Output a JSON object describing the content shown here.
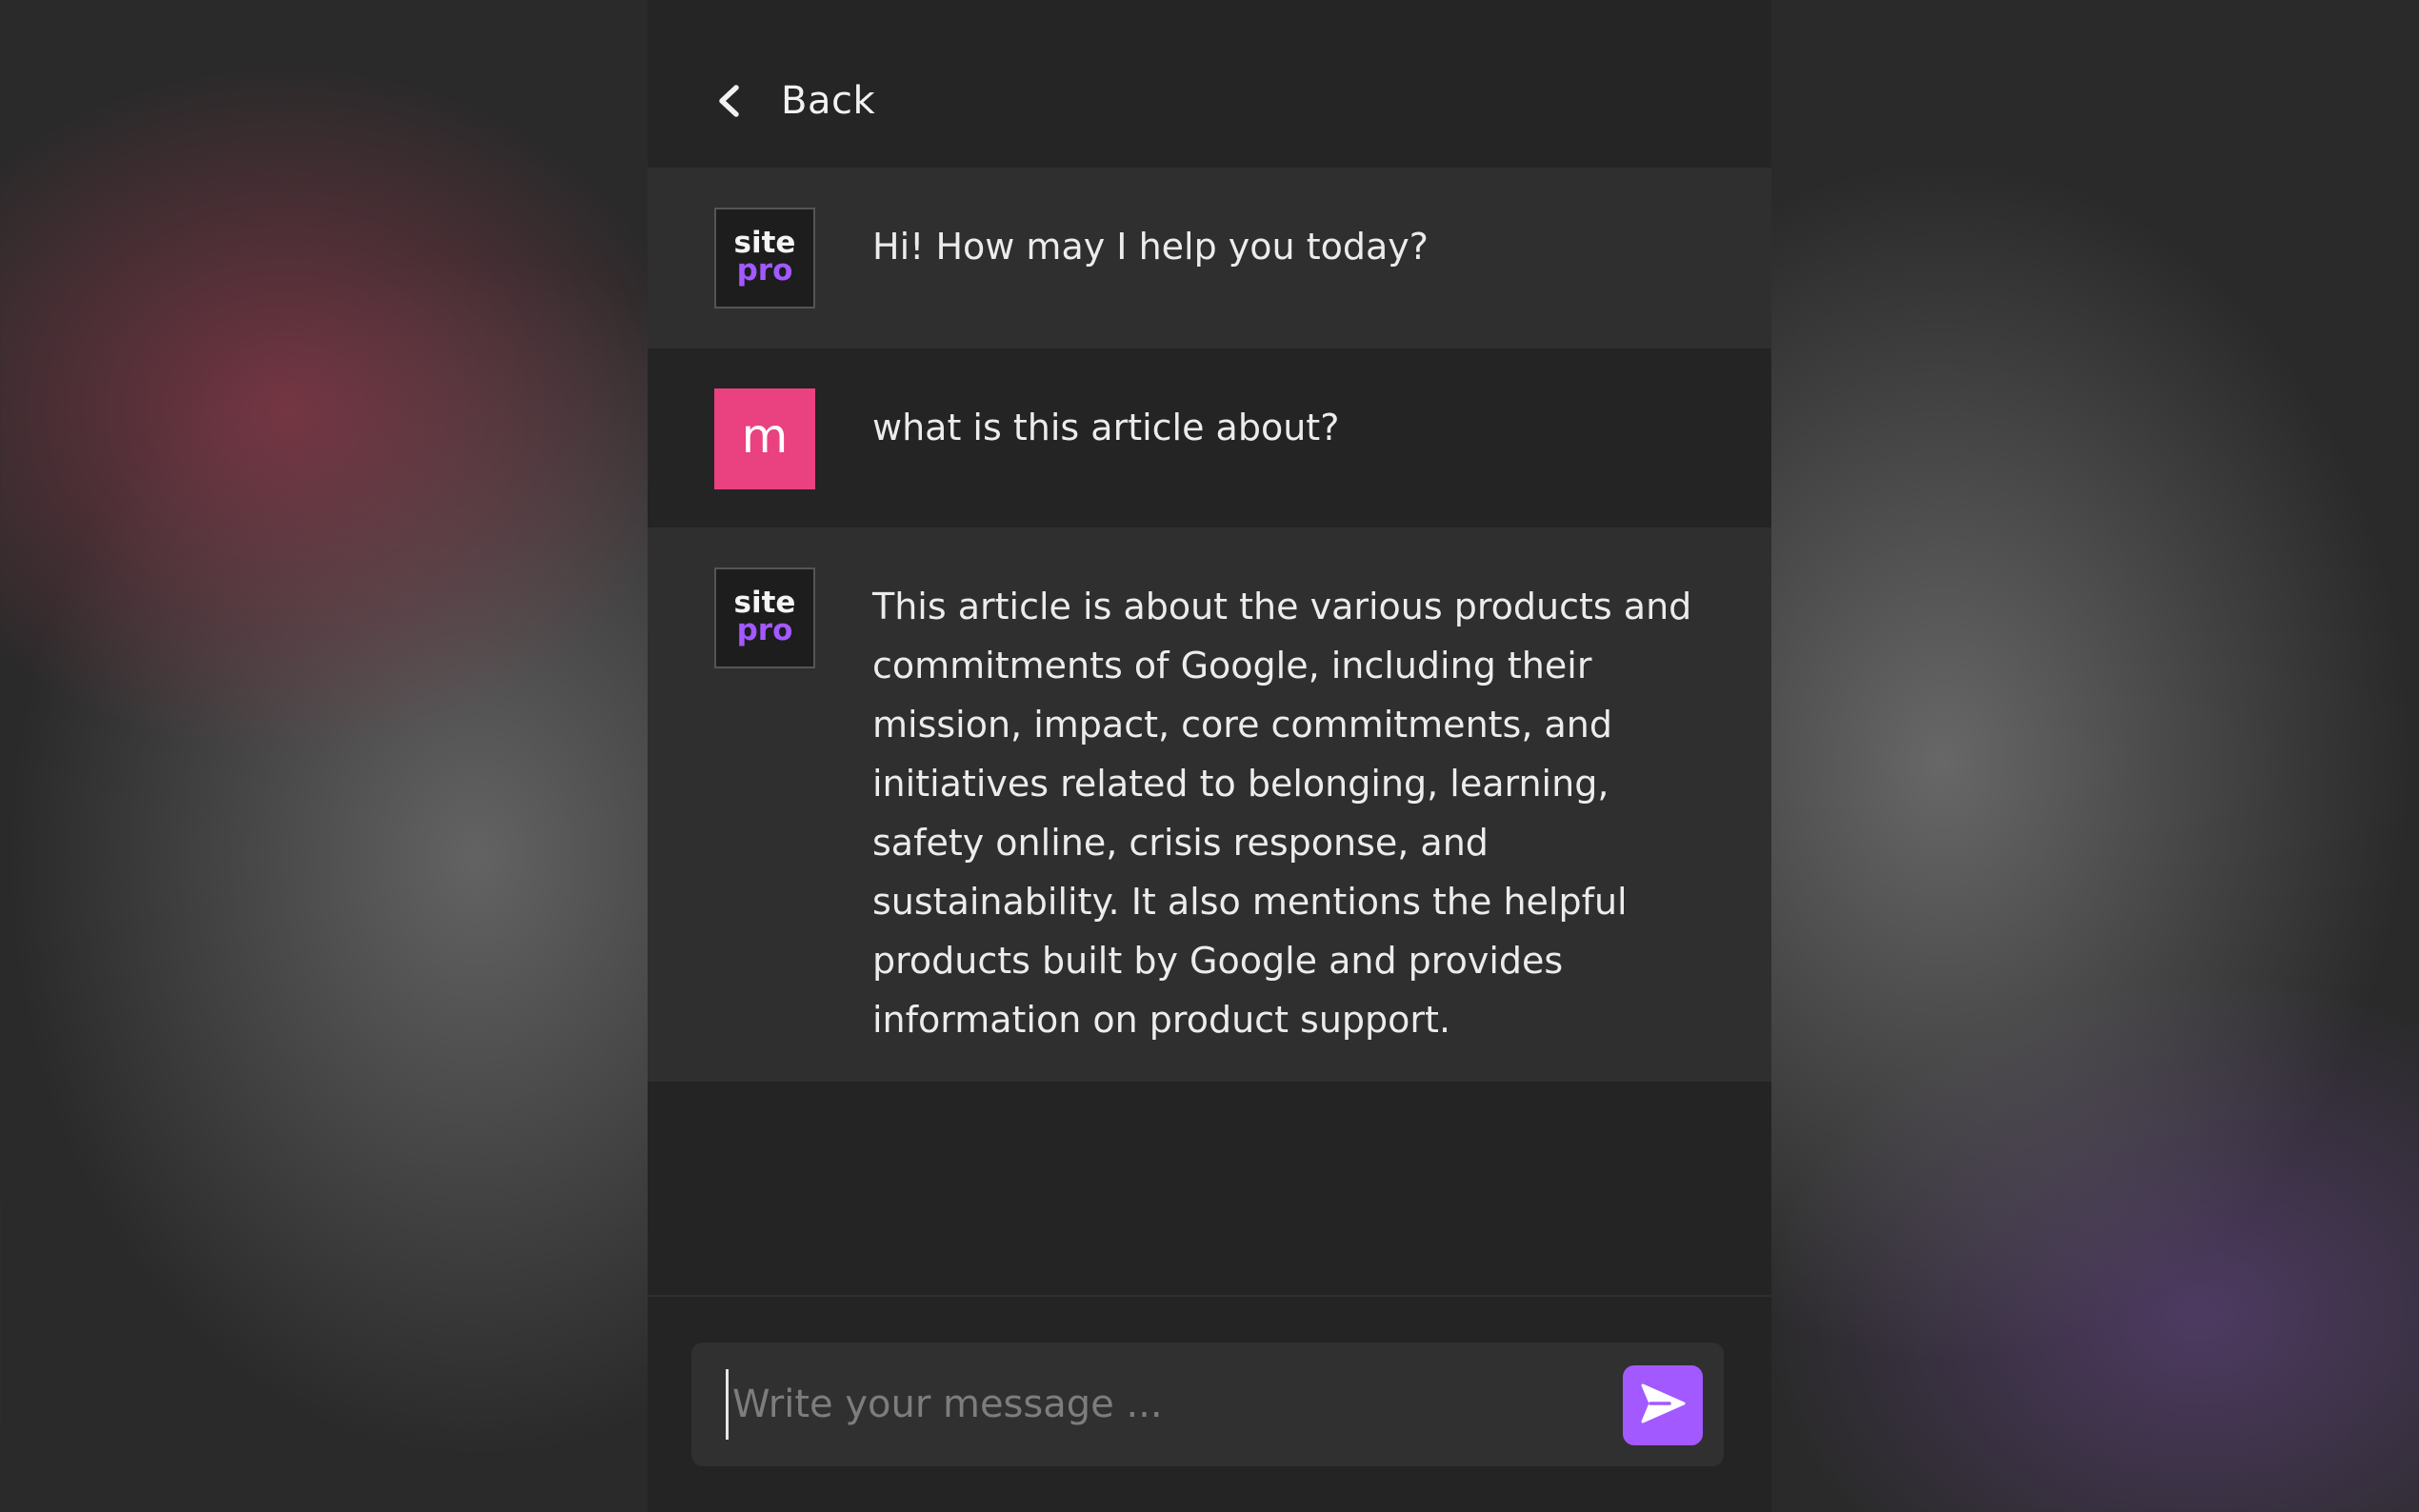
{
  "header": {
    "back_label": "Back",
    "back_icon": "chevron-left-icon"
  },
  "brand": {
    "logo_line1": "site",
    "logo_line2": "pro",
    "accent_color": "#a259ff"
  },
  "messages": [
    {
      "role": "assistant",
      "text": "Hi! How may I help you today?"
    },
    {
      "role": "user",
      "avatar_letter": "m",
      "avatar_color": "#ea4180",
      "text": "what is this article about?"
    },
    {
      "role": "assistant",
      "text": "This article is about the various products and commitments of Google, including their mission, impact, core commitments, and initiatives related to belonging, learning, safety online, crisis response, and sustainability. It also mentions the helpful products built by Google and provides information on product support."
    }
  ],
  "composer": {
    "placeholder": "Write your message ...",
    "value": "",
    "send_icon": "send-icon"
  }
}
